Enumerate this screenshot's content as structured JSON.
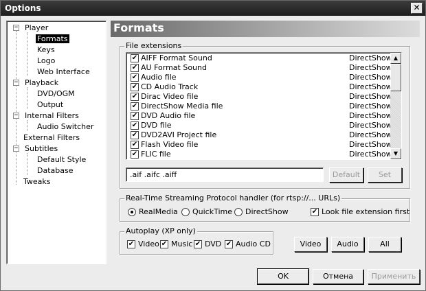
{
  "window": {
    "title": "Options",
    "close_glyph": "✕"
  },
  "tree": {
    "items": [
      {
        "label": "Player",
        "expander": "−"
      },
      {
        "label": "Formats"
      },
      {
        "label": "Keys"
      },
      {
        "label": "Logo"
      },
      {
        "label": "Web Interface"
      },
      {
        "label": "Playback",
        "expander": "−"
      },
      {
        "label": "DVD/OGM"
      },
      {
        "label": "Output"
      },
      {
        "label": "Internal Filters",
        "expander": "−"
      },
      {
        "label": "Audio Switcher"
      },
      {
        "label": "External Filters"
      },
      {
        "label": "Subtitles",
        "expander": "−"
      },
      {
        "label": "Default Style"
      },
      {
        "label": "Database"
      },
      {
        "label": "Tweaks"
      }
    ]
  },
  "page": {
    "title": "Formats"
  },
  "file_extensions": {
    "group_label": "File extensions",
    "rows": [
      {
        "name": "AIFF Format Sound",
        "type": "DirectShow",
        "checked": "✔"
      },
      {
        "name": "AU Format Sound",
        "type": "DirectShow",
        "checked": "✔"
      },
      {
        "name": "Audio file",
        "type": "DirectShow",
        "checked": "✔"
      },
      {
        "name": "CD Audio Track",
        "type": "DirectShow",
        "checked": "✔"
      },
      {
        "name": "Dirac Video file",
        "type": "DirectShow",
        "checked": "✔"
      },
      {
        "name": "DirectShow Media file",
        "type": "DirectShow",
        "checked": "✔"
      },
      {
        "name": "DVD Audio file",
        "type": "DirectShow",
        "checked": "✔"
      },
      {
        "name": "DVD file",
        "type": "DirectShow",
        "checked": "✔"
      },
      {
        "name": "DVD2AVI Project file",
        "type": "DirectShow",
        "checked": "✔"
      },
      {
        "name": "Flash Video file",
        "type": "DirectShow",
        "checked": "✔"
      },
      {
        "name": "FLIC file",
        "type": "DirectShow",
        "checked": "✔"
      }
    ],
    "ext_value": ".aif .aifc .aiff",
    "default_label": "Default",
    "set_label": "Set"
  },
  "rtsp": {
    "group_label": "Real-Time Streaming Protocol handler (for rtsp://... URLs)",
    "options": [
      "RealMedia",
      "QuickTime",
      "DirectShow"
    ],
    "selected": "RealMedia",
    "look_ext_label": "Look file extension first",
    "look_ext_checked": "✔"
  },
  "autoplay": {
    "group_label": "Autoplay (XP only)",
    "items": [
      {
        "label": "Video",
        "checked": "✔"
      },
      {
        "label": "Music",
        "checked": "✔"
      },
      {
        "label": "DVD",
        "checked": "✔"
      },
      {
        "label": "Audio CD",
        "checked": "✔"
      }
    ]
  },
  "quick_buttons": {
    "video": "Video",
    "audio": "Audio",
    "all": "All"
  },
  "footer": {
    "ok": "OK",
    "cancel": "Отмена",
    "apply": "Применить"
  },
  "scroll": {
    "up_glyph": "▲",
    "down_glyph": "▼"
  }
}
